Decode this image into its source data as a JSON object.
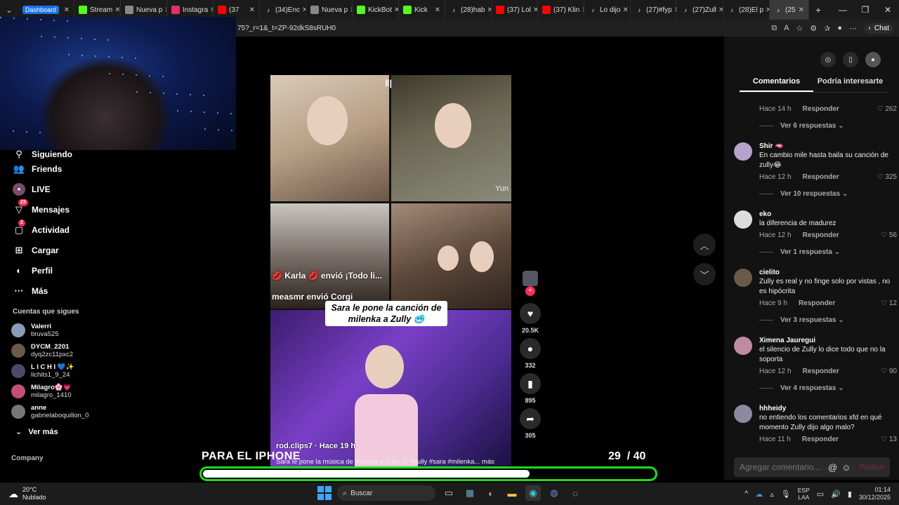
{
  "browser": {
    "tabs": [
      {
        "label": "Dashboard",
        "icon": "dashboard-icon",
        "color": "#1a73e8"
      },
      {
        "label": "Stream",
        "icon": "kick-icon",
        "color": "#53fc18"
      },
      {
        "label": "Nueva p",
        "icon": "page-icon",
        "color": "#888888"
      },
      {
        "label": "Instagra",
        "icon": "instagram-icon",
        "color": "#e1306c"
      },
      {
        "label": "(37",
        "icon": "youtube-icon",
        "color": "#ff0000"
      },
      {
        "label": "(34)Enc",
        "icon": "tiktok-icon",
        "color": "#ffffff"
      },
      {
        "label": "Nueva p",
        "icon": "page-icon",
        "color": "#888888"
      },
      {
        "label": "KickBot",
        "icon": "kick-icon",
        "color": "#53fc18"
      },
      {
        "label": "Kick",
        "icon": "kick-icon",
        "color": "#53fc18"
      },
      {
        "label": "(28)hab",
        "icon": "tiktok-icon",
        "color": "#ffffff"
      },
      {
        "label": "(37) Lol",
        "icon": "youtube-icon",
        "color": "#ff0000"
      },
      {
        "label": "(37) Klin",
        "icon": "youtube-icon",
        "color": "#ff0000"
      },
      {
        "label": "Lo dijo",
        "icon": "tiktok-icon",
        "color": "#ffffff"
      },
      {
        "label": "(27)#fyp",
        "icon": "tiktok-icon",
        "color": "#ffffff"
      },
      {
        "label": "(27)Zull",
        "icon": "tiktok-icon",
        "color": "#ffffff"
      },
      {
        "label": "(28)El p",
        "icon": "tiktok-icon",
        "color": "#ffffff"
      },
      {
        "label": "(25",
        "icon": "tiktok-icon",
        "color": "#ffffff",
        "active": true
      }
    ],
    "url": "75?_r=1&_t=ZP-92dkS8sRUH0",
    "chat_label": "Chat"
  },
  "sidebar": {
    "partial_item": "Siguiendo",
    "items": [
      {
        "label": "Friends",
        "icon": "friends-icon"
      },
      {
        "label": "LIVE",
        "icon": "live-icon"
      },
      {
        "label": "Mensajes",
        "icon": "messages-icon",
        "badge": "23"
      },
      {
        "label": "Actividad",
        "icon": "activity-icon",
        "badge": "2"
      },
      {
        "label": "Cargar",
        "icon": "upload-icon"
      },
      {
        "label": "Perfil",
        "icon": "profile-icon"
      },
      {
        "label": "Más",
        "icon": "more-icon"
      }
    ],
    "following_title": "Cuentas que sigues",
    "following": [
      {
        "name": "Valerri",
        "handle": "bruva525",
        "color": "#8a9bb5"
      },
      {
        "name": "DYCM_2201",
        "handle": "dyq2zc11pxc2",
        "color": "#6b5a4a"
      },
      {
        "name": "L I C H I 💙✨",
        "handle": "lichits1_9_24",
        "color": "#4a4a6a"
      },
      {
        "name": "Milagro🌸💗",
        "handle": "milagro_1410",
        "color": "#c0507a"
      },
      {
        "name": "anne",
        "handle": "gabrielaboquillon_0",
        "color": "#777777"
      }
    ],
    "see_more": "Ver más",
    "company": "Company"
  },
  "video": {
    "gift_line1": "💋 Karla 💋 envió ¡Todo li...",
    "gift_line2": "measmr envió Corgi",
    "streamer_tag": "Yun",
    "caption": "Sara le pone la canción de milenka a Zully 🥶",
    "author": "rod.clips7 · Hace 19 h",
    "description": "Sara le pone la música de Milenka a Zully 😮 #zully #sara #milenka...  más",
    "pause_icon": "pause-icon"
  },
  "actions": {
    "likes": "20.5K",
    "comments": "332",
    "saves": "895",
    "shares": "305"
  },
  "panel": {
    "tab_comments": "Comentarios",
    "tab_interest": "Podría interesarte",
    "first_meta": {
      "time": "Hace 14 h",
      "reply": "Responder",
      "likes": "262",
      "replies": "Ver 6 respuestas"
    },
    "comments": [
      {
        "name": "Shir 🫦",
        "text": "En cambio mile hasta baila su canción de zully😂",
        "time": "Hace 12 h",
        "reply": "Responder",
        "likes": "325",
        "replies": "Ver 10 respuestas",
        "color": "#b7a3c9"
      },
      {
        "name": "eko",
        "text": "la diferencia de madurez",
        "time": "Hace 12 h",
        "reply": "Responder",
        "likes": "56",
        "replies": "Ver 1 respuesta",
        "color": "#dddddd"
      },
      {
        "name": "cielito",
        "text": "Zully es real y no finge solo por vistas , no es hipócrita",
        "time": "Hace 9 h",
        "reply": "Responder",
        "likes": "12",
        "replies": "Ver 3 respuestas",
        "color": "#6a5a4a"
      },
      {
        "name": "Ximena Jauregui",
        "text": "el silencio de Zully lo dice todo que no la soporta",
        "time": "Hace 12 h",
        "reply": "Responder",
        "likes": "90",
        "replies": "Ver 4 respuestas",
        "color": "#c08aa0"
      },
      {
        "name": "hhheidy",
        "text": "no entiendo los comentarios xfd en qué momento Zully dijo algo malo?",
        "time": "Hace 11 h",
        "reply": "Responder",
        "likes": "13",
        "replies": "",
        "color": "#8a8aa0"
      }
    ],
    "input_placeholder": "Agregar comentario...",
    "publish": "Publicar"
  },
  "overlay": {
    "left_text": "PARA EL IPHONE",
    "counter_current": "29",
    "counter_total": "/ 40",
    "progress_fraction": 0.725,
    "border_color": "#19e019"
  },
  "taskbar": {
    "temp": "20°C",
    "weather": "Nublado",
    "search": "Buscar",
    "lang1": "ESP",
    "lang2": "LAA",
    "time": "01:14",
    "date": "30/12/2025"
  }
}
